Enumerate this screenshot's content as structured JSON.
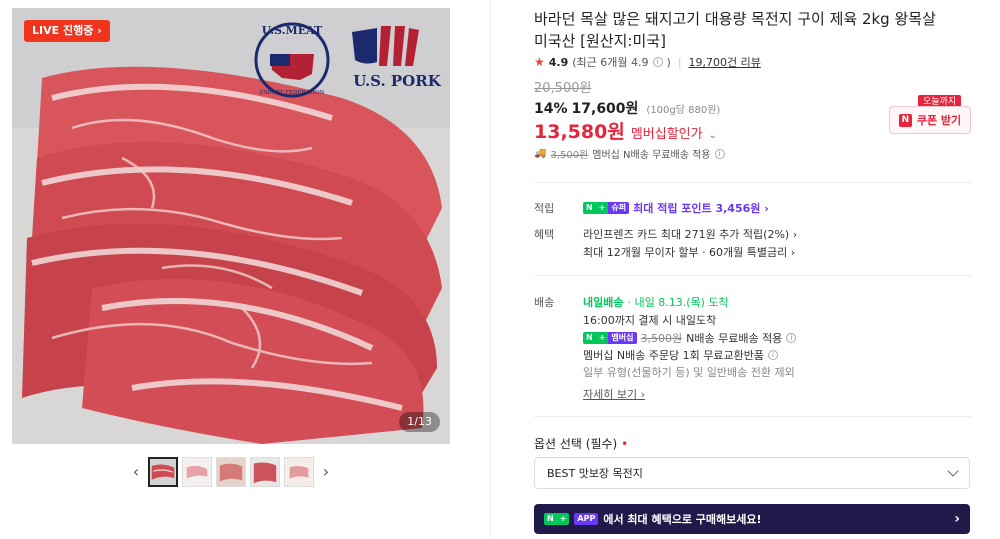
{
  "gallery": {
    "live_badge": "LIVE 진행중 ›",
    "counter": "1/13",
    "logo1_text_top": "U.S.MEAT",
    "logo1_text_bottom": "EXPORT FEDERATION",
    "logo2_text": "U.S. PORK",
    "thumb_prev": "‹",
    "thumb_next": "›",
    "thumb_count": 5
  },
  "product": {
    "title": "바라던 목살 많은 돼지고기 대용량 목전지 구이 제육 2kg 왕목살 미국산 [원산지:미국]",
    "rating": "4.9",
    "rating_recent": "(최근 6개월 4.9",
    "review_count": "19,700건 리뷰",
    "original_price": "20,500원",
    "discount_rate": "14%",
    "discount_price": "17,600원",
    "unit_price": "(100g당 880원)",
    "member_price": "13,580원",
    "member_label": "멤버십할인가",
    "coupon_tag": "오늘까지",
    "coupon_button": "쿠폰 받기",
    "shipping_orig": "3,500원",
    "shipping_text": "멤버십 N배송 무료배송 적용"
  },
  "benefits": {
    "points_label": "적립",
    "points_badge_n": "N",
    "points_badge_plus": "+",
    "points_badge_text": "슈퍼",
    "points_text": "최대 적립 포인트 3,456원 ›",
    "benefit_label": "혜택",
    "card_text": "라인프렌즈 카드 최대 271원 추가 적립(2%) ›",
    "installment_text": "최대 12개월 무이자 할부 · 60개월 특별금리 ›"
  },
  "delivery": {
    "label": "배송",
    "badge": "내일배송",
    "arrival": "· 내일 8.13.(목) 도착",
    "cutoff": "16:00까지 결제 시 내일도착",
    "badge2": "멤버십",
    "ship_orig": "3,500원",
    "ship_text": "N배송 무료배송 적용",
    "exchange": "멤버십 N배송 주문당 1회 무료교환반품",
    "exclude": "일부 유형(선물하기 등) 및 일반배송 전환 제외",
    "more": "자세히 보기 ›"
  },
  "option": {
    "label": "옵션 선택 (필수)",
    "required_mark": "•",
    "selected": "BEST 맛보장 목전지"
  },
  "promo": {
    "badge": "APP",
    "text": "에서 최대 혜택으로 구매해보세요!",
    "arrow": "›"
  },
  "colors": {
    "accent_red": "#e8243c",
    "npay_green": "#03c75a",
    "npay_purple": "#6b38f5",
    "promo_bg": "#201a4a"
  }
}
